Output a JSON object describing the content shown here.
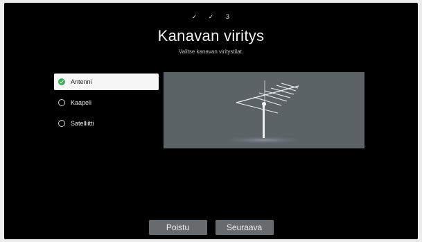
{
  "steps": [
    "✓",
    "✓",
    "3"
  ],
  "header": {
    "title": "Kanavan viritys",
    "subtitle": "Valitse kanavan viritystilat."
  },
  "tuning_options": [
    {
      "label": "Antenni",
      "selected": true
    },
    {
      "label": "Kaapeli",
      "selected": false
    },
    {
      "label": "Satelliitti",
      "selected": false
    }
  ],
  "preview": {
    "image": "antenna-illustration"
  },
  "buttons": {
    "back_label": "Poistu",
    "next_label": "Seuraava"
  },
  "colors": {
    "background": "#000000",
    "selected_option": "#f7f7f7",
    "check_green": "#3fae59",
    "button": "#676b6e",
    "preview_bg": "#5b6367"
  }
}
